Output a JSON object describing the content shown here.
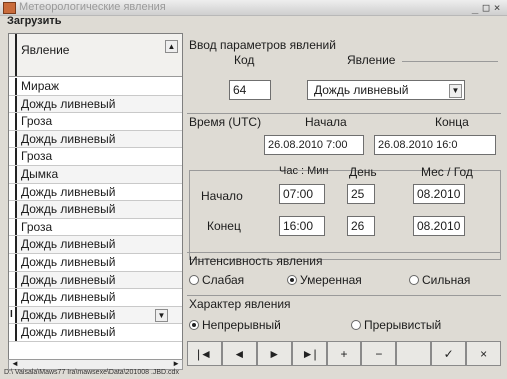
{
  "window": {
    "title": "Метеорологические явления",
    "controls": [
      "_",
      "□",
      "×"
    ]
  },
  "menu": {
    "load": "Загрузить"
  },
  "list": {
    "header": "Явление",
    "rows": [
      "Мираж",
      "Дождь ливневый",
      "Гроза",
      "Дождь ливневый",
      "Гроза",
      "Дымка",
      "Дождь ливневый",
      "Дождь ливневый",
      "Гроза",
      "Дождь ливневый",
      "Дождь ливневый",
      "Дождь ливневый",
      "Дождь ливневый",
      "Дождь ливневый",
      "Дождь ливневый"
    ],
    "current_marker": "I"
  },
  "params": {
    "group_title": "Ввод параметров явлений",
    "code_label": "Код",
    "phenomenon_label": "Явление",
    "code_value": "64",
    "phenomenon_value": "Дождь ливневый"
  },
  "time": {
    "label": "Время (UTC)",
    "start_label": "Начала",
    "end_label": "Конца",
    "start_value": "26.08.2010 7:00",
    "end_value": "26.08.2010 16:0",
    "col_hour_min": "Час : Мин",
    "col_day": "День",
    "col_month_year": "Мес / Год",
    "row_start": "Начало",
    "row_end": "Конец",
    "start_hm": "07:00",
    "start_day": "25",
    "start_my": "08.2010",
    "end_hm": "16:00",
    "end_day": "26",
    "end_my": "08.2010"
  },
  "intensity": {
    "title": "Интенсивность явления",
    "options": [
      "Слабая",
      "Умеренная",
      "Сильная"
    ],
    "selected": 1
  },
  "character": {
    "title": "Характер явления",
    "options": [
      "Непрерывный",
      "Прерывистый"
    ],
    "selected": 0
  },
  "nav": {
    "first": "|◄",
    "prev": "◄",
    "next": "►",
    "last": "►|",
    "add": "+",
    "delete": "−",
    "edit": "",
    "post": "✓",
    "cancel": "×"
  },
  "status": {
    "path": "D:\\ Vaisala\\Maws77  Ira\\mawsexe\\Data\\201008 .JBD.cdx"
  }
}
